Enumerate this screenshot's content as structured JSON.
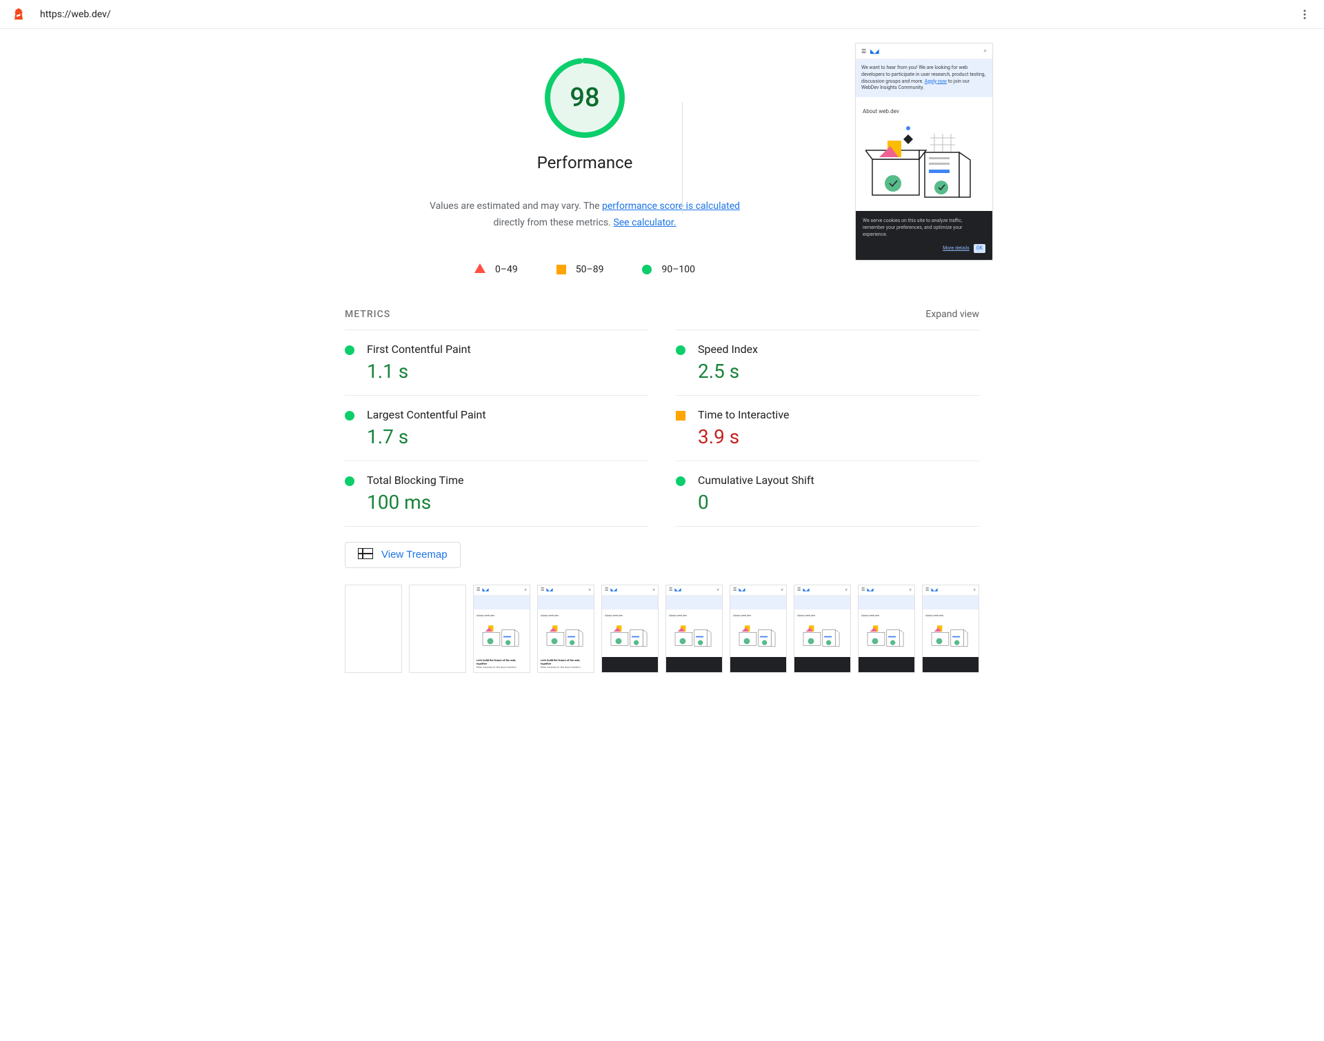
{
  "header": {
    "url": "https://web.dev/"
  },
  "performance": {
    "score": "98",
    "title": "Performance",
    "subtitle_prefix": "Values are estimated and may vary. The ",
    "link1": "performance score is calculated",
    "subtitle_mid": " directly from these metrics. ",
    "link2": "See calculator."
  },
  "legend": [
    {
      "range": "0–49",
      "shape": "triangle",
      "color": "#ff4e42"
    },
    {
      "range": "50–89",
      "shape": "square",
      "color": "#ffa400"
    },
    {
      "range": "90–100",
      "shape": "circle",
      "color": "#0cce6b"
    }
  ],
  "screenshot": {
    "banner_text": "We want to hear from you! We are looking for web developers to participate in user research, product testing, discussion groups and more. ",
    "banner_link": "Apply now",
    "banner_suffix": " to join our WebDev Insights Community.",
    "about": "About web.dev",
    "cookie_text": "We serve cookies on this site to analyze traffic, remember your preferences, and optimize your experience.",
    "more_details": "More details",
    "ok": "OK"
  },
  "metrics": {
    "heading": "METRICS",
    "expand": "Expand view",
    "items": [
      {
        "name": "First Contentful Paint",
        "value": "1.1 s",
        "status": "pass"
      },
      {
        "name": "Speed Index",
        "value": "2.5 s",
        "status": "pass"
      },
      {
        "name": "Largest Contentful Paint",
        "value": "1.7 s",
        "status": "pass"
      },
      {
        "name": "Time to Interactive",
        "value": "3.9 s",
        "status": "avg"
      },
      {
        "name": "Total Blocking Time",
        "value": "100 ms",
        "status": "pass"
      },
      {
        "name": "Cumulative Layout Shift",
        "value": "0",
        "status": "pass"
      }
    ]
  },
  "treemap_label": "View Treemap",
  "filmstrip": {
    "thumbs": [
      {
        "state": "blank"
      },
      {
        "state": "blank"
      },
      {
        "state": "partial"
      },
      {
        "state": "partial"
      },
      {
        "state": "cookie"
      },
      {
        "state": "cookie"
      },
      {
        "state": "cookie"
      },
      {
        "state": "cookie"
      },
      {
        "state": "cookie"
      },
      {
        "state": "cookie"
      }
    ],
    "partial_text": "Let's build the future of the web, together",
    "partial_sub": "New courses in the docs section"
  },
  "colors": {
    "pass": "#0cce6b",
    "avg": "#ffa400",
    "fail": "#ff4e42",
    "pass_text": "#178239",
    "avg_text": "#c5221f"
  }
}
